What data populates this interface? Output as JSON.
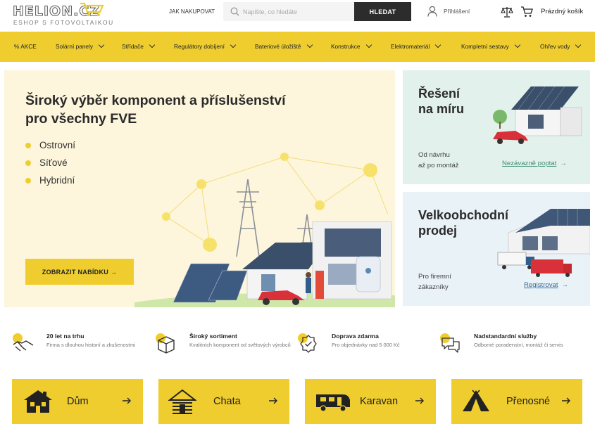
{
  "header": {
    "logo_text": "HELION.CZ",
    "logo_tagline": "ESHOP S FOTOVOLTAIKOU",
    "how_to_buy": "JAK NAKUPOVAT",
    "search": {
      "placeholder": "Napište, co hledáte",
      "value": "",
      "button": "HLEDAT"
    },
    "login": "Přihlášení",
    "cart": "Prázdný košík"
  },
  "nav": {
    "items": [
      {
        "label": "% AKCE",
        "has_dropdown": false
      },
      {
        "label": "Solární panely",
        "has_dropdown": true
      },
      {
        "label": "Střídače",
        "has_dropdown": true
      },
      {
        "label": "Regulátory dobíjení",
        "has_dropdown": true
      },
      {
        "label": "Bateriové úložiště",
        "has_dropdown": true
      },
      {
        "label": "Konstrukce",
        "has_dropdown": true
      },
      {
        "label": "Elektromateriál",
        "has_dropdown": true
      },
      {
        "label": "Kompletní sestavy",
        "has_dropdown": true
      },
      {
        "label": "Ohřev vody",
        "has_dropdown": true
      }
    ]
  },
  "hero": {
    "title": "Široký výběr komponent a příslušenství pro všechny FVE",
    "list": [
      "Ostrovní",
      "Síťové",
      "Hybridní"
    ],
    "button": "ZOBRAZIT NABÍDKU",
    "button_arrow": "→"
  },
  "cards": [
    {
      "title": "Řešení\nna míru",
      "subtitle": "Od návrhu\naž po montáž",
      "link": "Nezávazně poptat",
      "arrow": "→"
    },
    {
      "title": "Velkoobchodní\nprodej",
      "subtitle": "Pro firemní\nzákazníky",
      "link": "Registrovat",
      "arrow": "→"
    }
  ],
  "features": [
    {
      "icon": "handshake-icon",
      "title": "20 let na trhu",
      "desc": "Firma s dlouhou historií a zkušenostmi"
    },
    {
      "icon": "box-icon",
      "title": "Široký sortiment",
      "desc": "Kvalitních komponent od světových výrobců"
    },
    {
      "icon": "badge-check-icon",
      "title": "Doprava zdarma",
      "desc": "Pro objednávky nad 5 000 Kč"
    },
    {
      "icon": "chat-icon",
      "title": "Nadstandardní služby",
      "desc": "Odborné poradenství, montáž či servis"
    }
  ],
  "categories": [
    {
      "icon": "house-icon",
      "label": "Dům"
    },
    {
      "icon": "cabin-icon",
      "label": "Chata"
    },
    {
      "icon": "caravan-icon",
      "label": "Karavan"
    },
    {
      "icon": "tent-icon",
      "label": "Přenosné"
    }
  ],
  "colors": {
    "accent_yellow": "#f0cd2e",
    "hero_bg": "#fdf6dc",
    "card_green_bg": "#e3f1ec",
    "card_blue_bg": "#e9f2f7",
    "link_green": "#3f8e72",
    "link_blue": "#3a6b95",
    "search_button": "#2c2c2c"
  }
}
